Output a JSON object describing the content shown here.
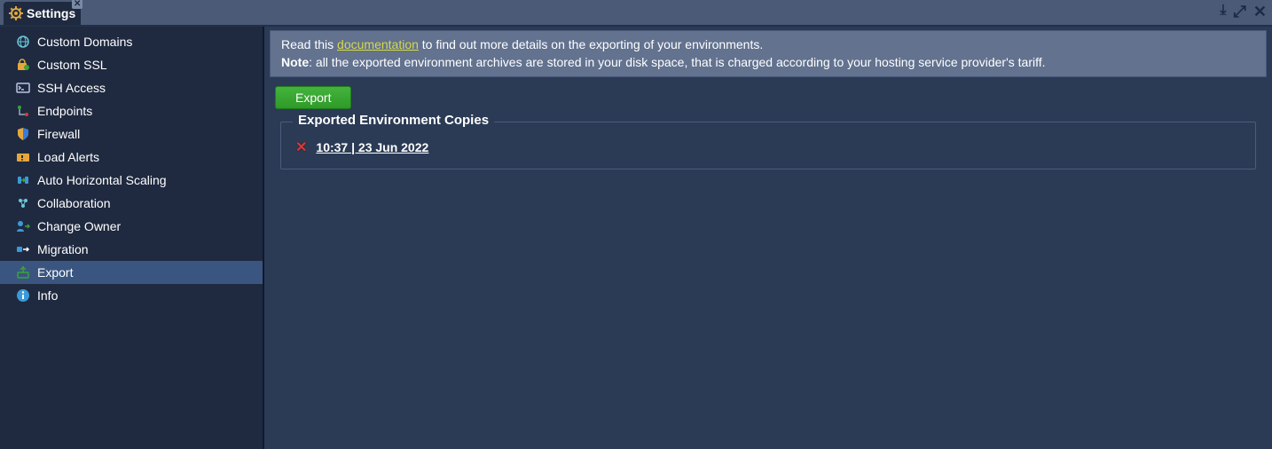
{
  "tab": {
    "title": "Settings"
  },
  "sidebar": {
    "items": [
      {
        "label": "Custom Domains",
        "name": "custom-domains",
        "icon": "globe"
      },
      {
        "label": "Custom SSL",
        "name": "custom-ssl",
        "icon": "lock"
      },
      {
        "label": "SSH Access",
        "name": "ssh-access",
        "icon": "terminal"
      },
      {
        "label": "Endpoints",
        "name": "endpoints",
        "icon": "endpoint"
      },
      {
        "label": "Firewall",
        "name": "firewall",
        "icon": "shield"
      },
      {
        "label": "Load Alerts",
        "name": "load-alerts",
        "icon": "alert"
      },
      {
        "label": "Auto Horizontal Scaling",
        "name": "auto-horizontal-scaling",
        "icon": "scale"
      },
      {
        "label": "Collaboration",
        "name": "collaboration",
        "icon": "collab"
      },
      {
        "label": "Change Owner",
        "name": "change-owner",
        "icon": "owner"
      },
      {
        "label": "Migration",
        "name": "migration",
        "icon": "migrate"
      },
      {
        "label": "Export",
        "name": "export",
        "icon": "export",
        "active": true
      },
      {
        "label": "Info",
        "name": "info",
        "icon": "info"
      }
    ]
  },
  "banner": {
    "pre": "Read this ",
    "link": "documentation",
    "post": " to find out more details on the exporting of your environments.",
    "note_label": "Note",
    "note_text": ": all the exported environment archives are stored in your disk space, that is charged according to your hosting service provider's tariff."
  },
  "toolbar": {
    "export_label": "Export"
  },
  "section": {
    "title": "Exported Environment Copies",
    "copies": [
      {
        "timestamp": "10:37 | 23 Jun 2022"
      }
    ]
  }
}
